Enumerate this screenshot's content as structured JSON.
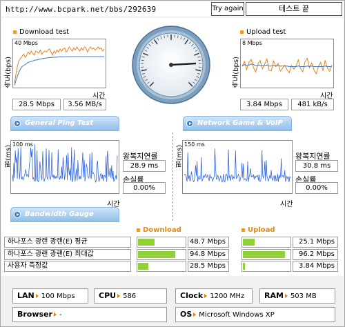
{
  "top": {
    "url": "http://www.bcpark.net/bbs/292639",
    "try_again": "Try again",
    "status": "테스트 끝"
  },
  "download": {
    "title": "Download test",
    "ylabel": "속도(bps)",
    "scale": "40 Mbps",
    "xlabel": "시간",
    "mbps": "28.5 Mbps",
    "mbs": "3.56 MB/s",
    "chart_data": {
      "type": "line",
      "ylim": [
        0,
        40
      ],
      "series": [
        {
          "values": [
            3,
            12,
            20,
            25,
            27,
            29,
            31,
            28,
            30,
            33,
            31,
            34,
            32,
            30,
            34,
            33,
            32,
            35,
            31,
            33,
            34,
            33,
            35,
            36,
            33,
            30,
            34,
            32,
            35,
            33,
            36,
            34,
            36,
            37,
            33,
            35,
            38,
            36,
            34,
            37,
            35,
            38,
            36,
            34,
            37,
            35,
            38,
            37,
            33,
            36,
            38,
            36,
            37,
            35,
            36,
            38,
            36,
            37,
            34,
            36
          ]
        },
        {
          "values": [
            1,
            6,
            10,
            14,
            17,
            19,
            20,
            21,
            22,
            23,
            23.5,
            24,
            24.5,
            25,
            25.3,
            25.6,
            26,
            26.3,
            26.6,
            26.9,
            27.1,
            27.3,
            27.5,
            27.7,
            27.8,
            27.9,
            28,
            28.1,
            28.2,
            28.3,
            28.3,
            28.4,
            28.4,
            28.5,
            28.5,
            28.5,
            28.5,
            28.6,
            28.6,
            28.6,
            28.6,
            28.6,
            28.6,
            28.6,
            28.6,
            28.6,
            28.6,
            28.6,
            28.6,
            28.6,
            28.6,
            28.6,
            28.6,
            28.6,
            28.6,
            28.6,
            28.6,
            28.6,
            28.6,
            28.6
          ]
        }
      ]
    }
  },
  "upload": {
    "title": "Upload test",
    "ylabel": "속도(bps)",
    "scale": "8 Mbps",
    "xlabel": "시간",
    "mbps": "3.84 Mbps",
    "kbs": "481 kB/s",
    "chart_data": {
      "type": "line",
      "ylim": [
        0,
        8
      ],
      "series": [
        {
          "values": [
            3.9,
            4.8,
            3.2,
            4.6,
            5.2,
            3.6,
            2.8,
            4.3,
            5.0,
            3.4,
            4.2,
            5.3,
            3.1,
            3.0,
            4.9,
            3.8,
            4.4,
            2.9,
            3.5,
            4.1,
            3.2,
            2.6,
            4.0,
            3.3,
            3.9,
            5.1,
            3.4,
            2.8,
            4.7,
            5.4,
            3.6,
            4.5,
            3.2,
            2.4,
            3.8,
            4.6,
            3.0,
            5.0,
            3.5,
            2.9,
            4.1
          ]
        },
        {
          "values": [
            3.9,
            4.2,
            4.0,
            4.1,
            4.3,
            4.2,
            4.0,
            4.0,
            4.1,
            4.0,
            4.0,
            4.1,
            3.9,
            3.9,
            4.0,
            3.9,
            4.0,
            3.9,
            3.9,
            3.9,
            3.9,
            3.8,
            3.8,
            3.8,
            3.8,
            3.9,
            3.8,
            3.8,
            3.8,
            3.9,
            3.8,
            3.9,
            3.8,
            3.8,
            3.8,
            3.8,
            3.8,
            3.9,
            3.8,
            3.8,
            3.84
          ]
        }
      ]
    }
  },
  "ping_tab": "General Ping Test",
  "game_tab": "Network Game & VoIP Test",
  "bandwidth_tab": "Bandwidth Gauge",
  "ping1": {
    "ylabel": "핑(ms)",
    "scale": "100 ms",
    "xlabel": "시간",
    "rtt_label": "왕복지연률",
    "rtt": "28.9 ms",
    "loss_label": "손실률",
    "loss": "0.00%"
  },
  "ping2": {
    "ylabel": "핑(ms)",
    "scale": "150 ms",
    "xlabel": "시간",
    "rtt_label": "왕복지연률",
    "rtt": "30.8 ms",
    "loss_label": "손실률",
    "loss": "0.00%"
  },
  "gauge": {
    "download_header": "Download",
    "upload_header": "Upload",
    "rows": [
      {
        "label": "하나포스 광랜 광랜(E) 평균",
        "down": "48.7 Mbps",
        "down_frac": 0.36,
        "up": "25.1 Mbps",
        "up_frac": 0.25
      },
      {
        "label": "하나포스 광랜 광랜(E) 최대값",
        "down": "94.8 Mbps",
        "down_frac": 0.8,
        "up": "96.2 Mbps",
        "up_frac": 0.9
      },
      {
        "label": "사용자 측정값",
        "down": "28.5 Mbps",
        "down_frac": 0.22,
        "up": "3.84 Mbps",
        "up_frac": 0.04
      }
    ]
  },
  "system": {
    "lan_label": "LAN",
    "lan": "100 Mbps",
    "cpu_label": "CPU",
    "cpu": "586",
    "clock_label": "Clock",
    "clock": "1200 MHz",
    "ram_label": "RAM",
    "ram": "503 MB",
    "browser_label": "Browser",
    "browser": "-",
    "os_label": "OS",
    "os": "Microsoft Windows XP"
  }
}
